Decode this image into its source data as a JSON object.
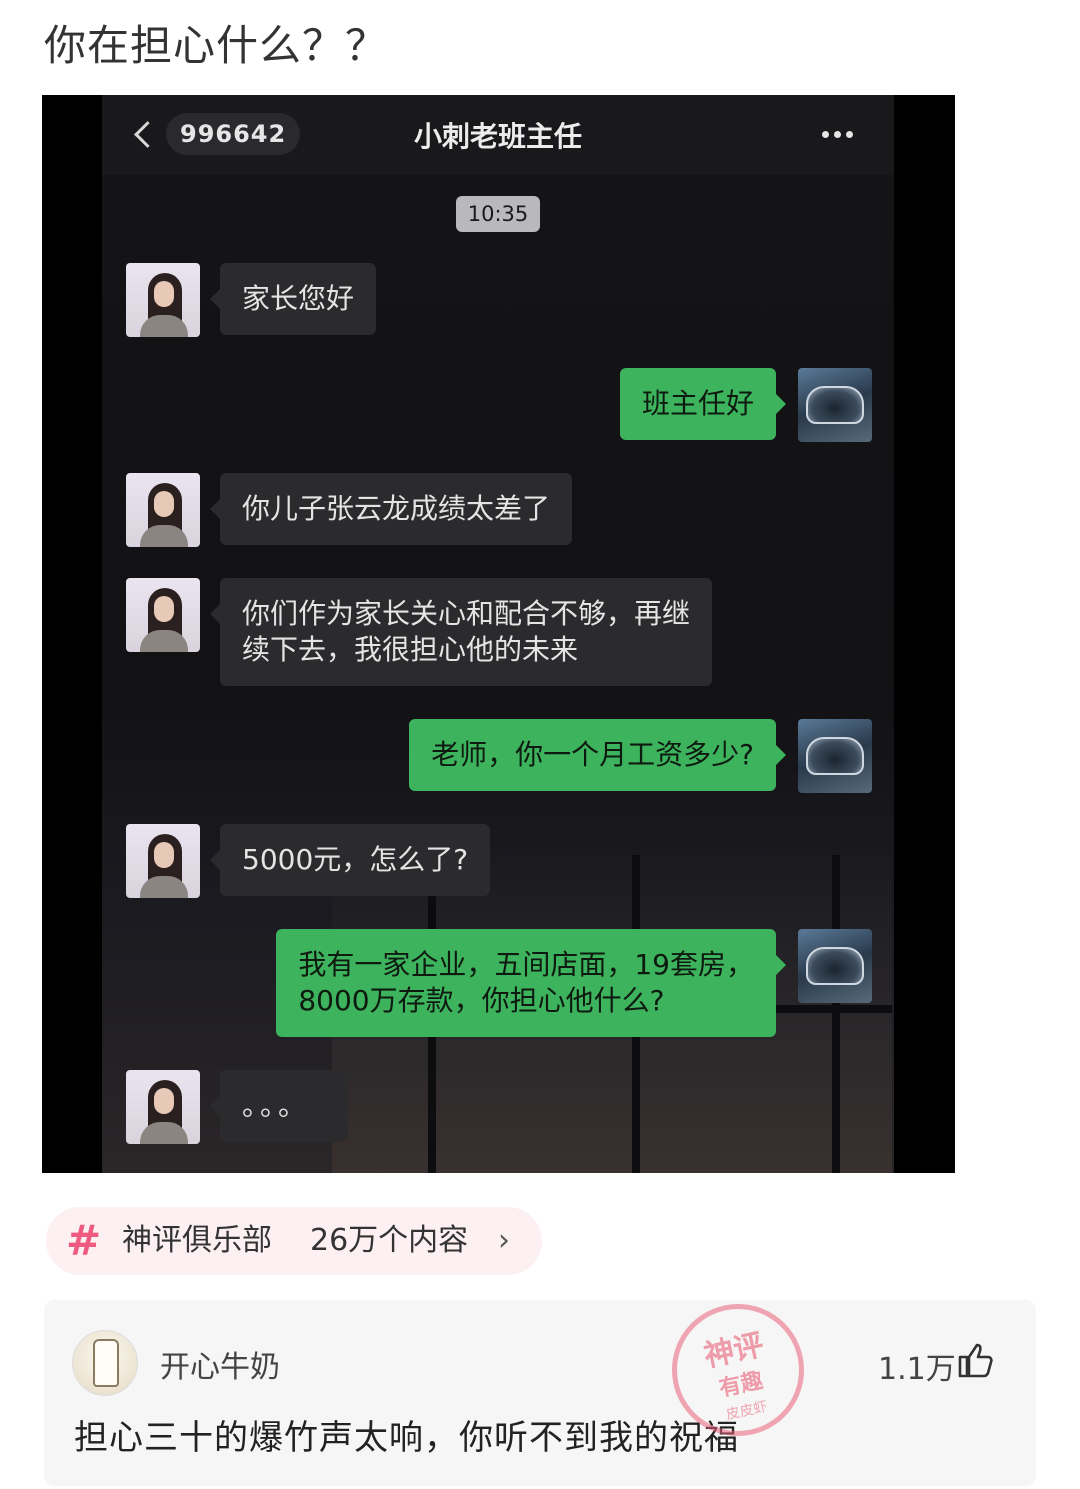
{
  "post": {
    "title": "你在担心什么？？"
  },
  "chat": {
    "unread_count": "996642",
    "title": "小刺老班主任",
    "time": "10:35",
    "messages": [
      {
        "from": "teacher",
        "text": "家长您好"
      },
      {
        "from": "parent",
        "text": "班主任好"
      },
      {
        "from": "teacher",
        "text": "你儿子张云龙成绩太差了"
      },
      {
        "from": "teacher",
        "line1": "你们作为家长关心和配合不够，再继",
        "line2": "续下去，我很担心他的未来"
      },
      {
        "from": "parent",
        "text": "老师，你一个月工资多少?"
      },
      {
        "from": "teacher",
        "text": "5000元，怎么了?"
      },
      {
        "from": "parent",
        "line1": "我有一家企业，五间店面，19套房，",
        "line2": "8000万存款，你担心他什么?"
      },
      {
        "from": "teacher",
        "text": "。。。"
      }
    ]
  },
  "topic": {
    "hash": "#",
    "name": "神评俱乐部",
    "count": "26万个内容",
    "arrow": "›"
  },
  "comment": {
    "user": "开心牛奶",
    "text": "担心三十的爆竹声太响，你听不到我的祝福",
    "likes": "1.1万",
    "stamp": {
      "line1": "神评",
      "line2": "有趣",
      "line3": "皮皮虾"
    }
  },
  "colors": {
    "bubble_out": "#3cb35c",
    "bubble_in": "#2b2b2e",
    "topic_accent": "#ee5a80"
  }
}
